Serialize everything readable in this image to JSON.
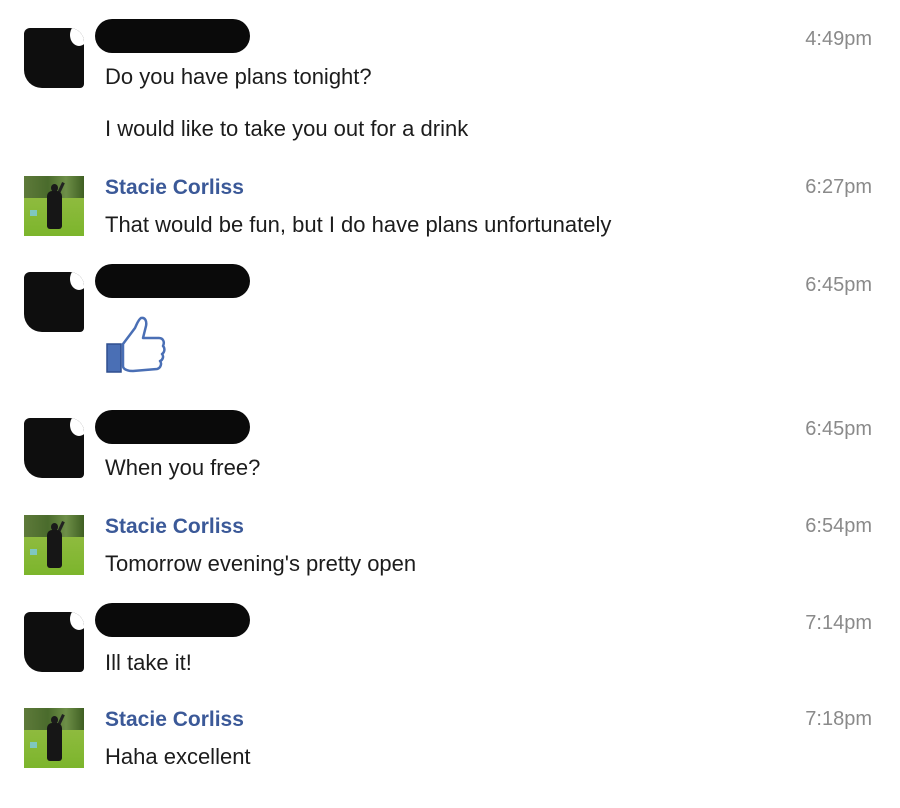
{
  "messages": [
    {
      "sender": "",
      "redacted": true,
      "time": "4:49pm",
      "lines": [
        "Do you have plans tonight?",
        "I would like to take you out for a drink"
      ]
    },
    {
      "sender": "Stacie Corliss",
      "redacted": false,
      "time": "6:27pm",
      "lines": [
        "That would be fun, but I do have plans unfortunately"
      ]
    },
    {
      "sender": "",
      "redacted": true,
      "time": "6:45pm",
      "lines": [],
      "sticker": "thumbs-up-like-icon"
    },
    {
      "sender": "",
      "redacted": true,
      "time": "6:45pm",
      "lines": [
        "When you free?"
      ]
    },
    {
      "sender": "Stacie Corliss",
      "redacted": false,
      "time": "6:54pm",
      "lines": [
        "Tomorrow evening's pretty open"
      ]
    },
    {
      "sender": "",
      "redacted": true,
      "time": "7:14pm",
      "lines": [
        "Ill take it!"
      ]
    },
    {
      "sender": "Stacie Corliss",
      "redacted": false,
      "time": "7:18pm",
      "lines": [
        "Haha excellent"
      ]
    }
  ],
  "colors": {
    "sender_name": "#3b5998",
    "timestamp": "#8a8a8a",
    "message_text": "#1c1c1c",
    "like_icon": "#4a6fb5"
  }
}
